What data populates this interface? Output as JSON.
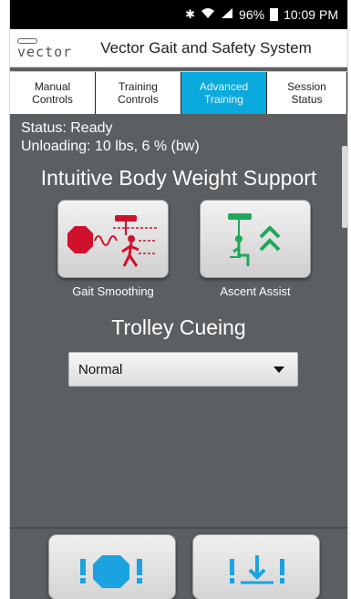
{
  "status_bar": {
    "battery_pct": "96%",
    "time": "10:09 PM",
    "icons": [
      "bluetooth-icon",
      "wifi-icon",
      "signal-icon",
      "battery-icon"
    ]
  },
  "app": {
    "logo_text": "vector",
    "title": "Vector Gait and Safety System"
  },
  "tabs": [
    {
      "label": "Manual\nControls",
      "active": false
    },
    {
      "label": "Training\nControls",
      "active": false
    },
    {
      "label": "Advanced\nTraining",
      "active": true
    },
    {
      "label": "Session\nStatus",
      "active": false
    }
  ],
  "status": {
    "status_text": "Status:   Ready",
    "unloading_text": "Unloading: 10 lbs, 6 % (bw)"
  },
  "ibws": {
    "title": "Intuitive Body Weight Support",
    "buttons": [
      {
        "label": "Gait Smoothing",
        "icon": "gait-smoothing-icon"
      },
      {
        "label": "Ascent Assist",
        "icon": "ascent-assist-icon"
      }
    ]
  },
  "trolley": {
    "title": "Trolley Cueing",
    "selected": "Normal"
  },
  "bottom_buttons": [
    {
      "icon": "emergency-stop-icon"
    },
    {
      "icon": "lower-to-ground-icon"
    }
  ],
  "colors": {
    "accent_tab": "#0aa9de",
    "background": "#5b5f62",
    "stop_red": "#d0112b",
    "assist_green": "#1ea85a",
    "stop_blue": "#1aa3e0"
  }
}
